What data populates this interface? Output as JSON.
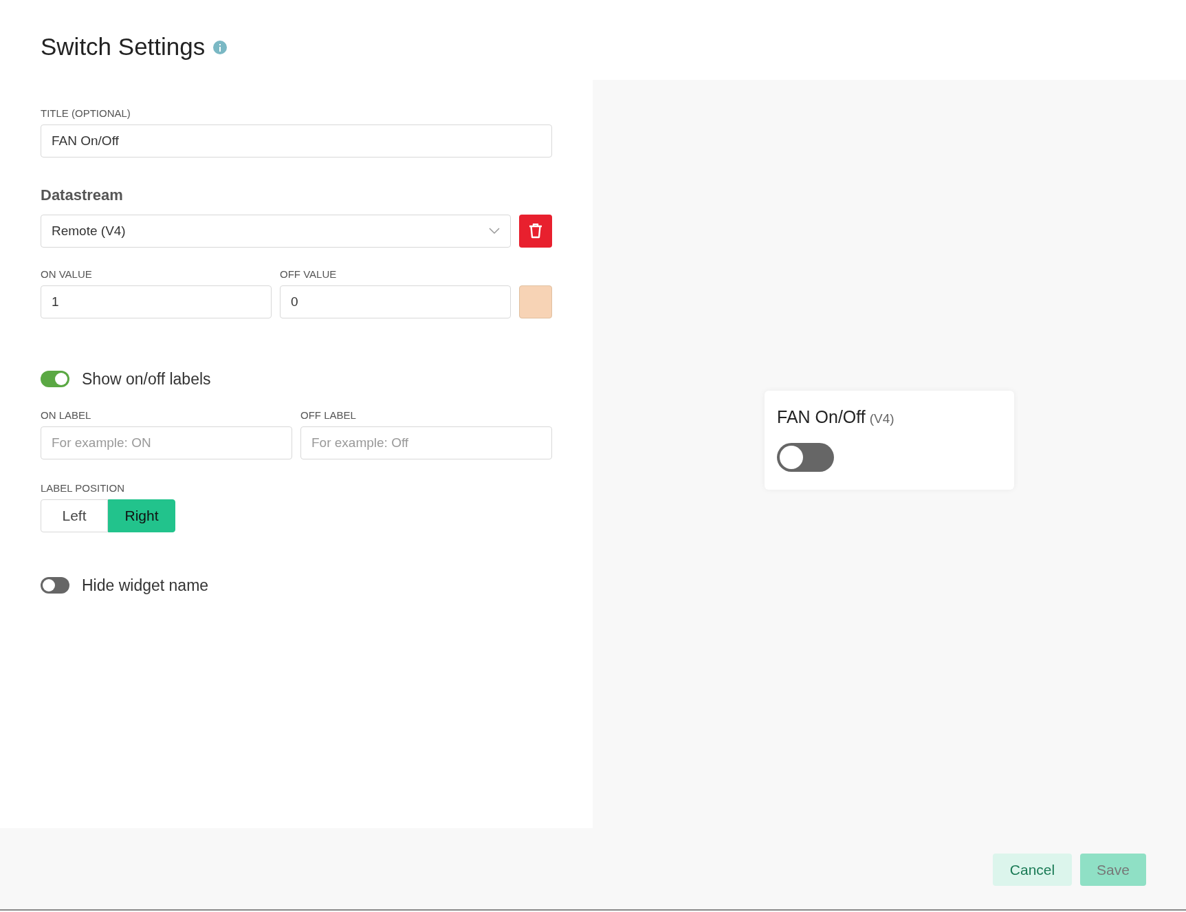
{
  "dialog": {
    "title": "Switch Settings"
  },
  "form": {
    "title_field": {
      "label": "TITLE (OPTIONAL)",
      "value": "FAN On/Off"
    },
    "datastream": {
      "heading": "Datastream",
      "value": "Remote (V4)"
    },
    "on_value": {
      "label": "ON VALUE",
      "value": "1"
    },
    "off_value": {
      "label": "OFF VALUE",
      "value": "0"
    },
    "color_swatch": {
      "color": "#f7d3b5"
    },
    "show_labels": {
      "label": "Show on/off labels",
      "on": true
    },
    "on_label": {
      "label": "ON LABEL",
      "placeholder": "For example: ON"
    },
    "off_label": {
      "label": "OFF LABEL",
      "placeholder": "For example: Off"
    },
    "label_position": {
      "label": "LABEL POSITION",
      "options": [
        {
          "label": "Left",
          "selected": false
        },
        {
          "label": "Right",
          "selected": true
        }
      ]
    },
    "hide_widget_name": {
      "label": "Hide widget name",
      "on": false
    }
  },
  "preview": {
    "title": "FAN On/Off",
    "pin": "(V4)",
    "on": false
  },
  "buttons": [
    {
      "label": "Cancel",
      "kind": "secondary",
      "disabled": false
    },
    {
      "label": "Save",
      "kind": "primary",
      "disabled": true
    }
  ]
}
